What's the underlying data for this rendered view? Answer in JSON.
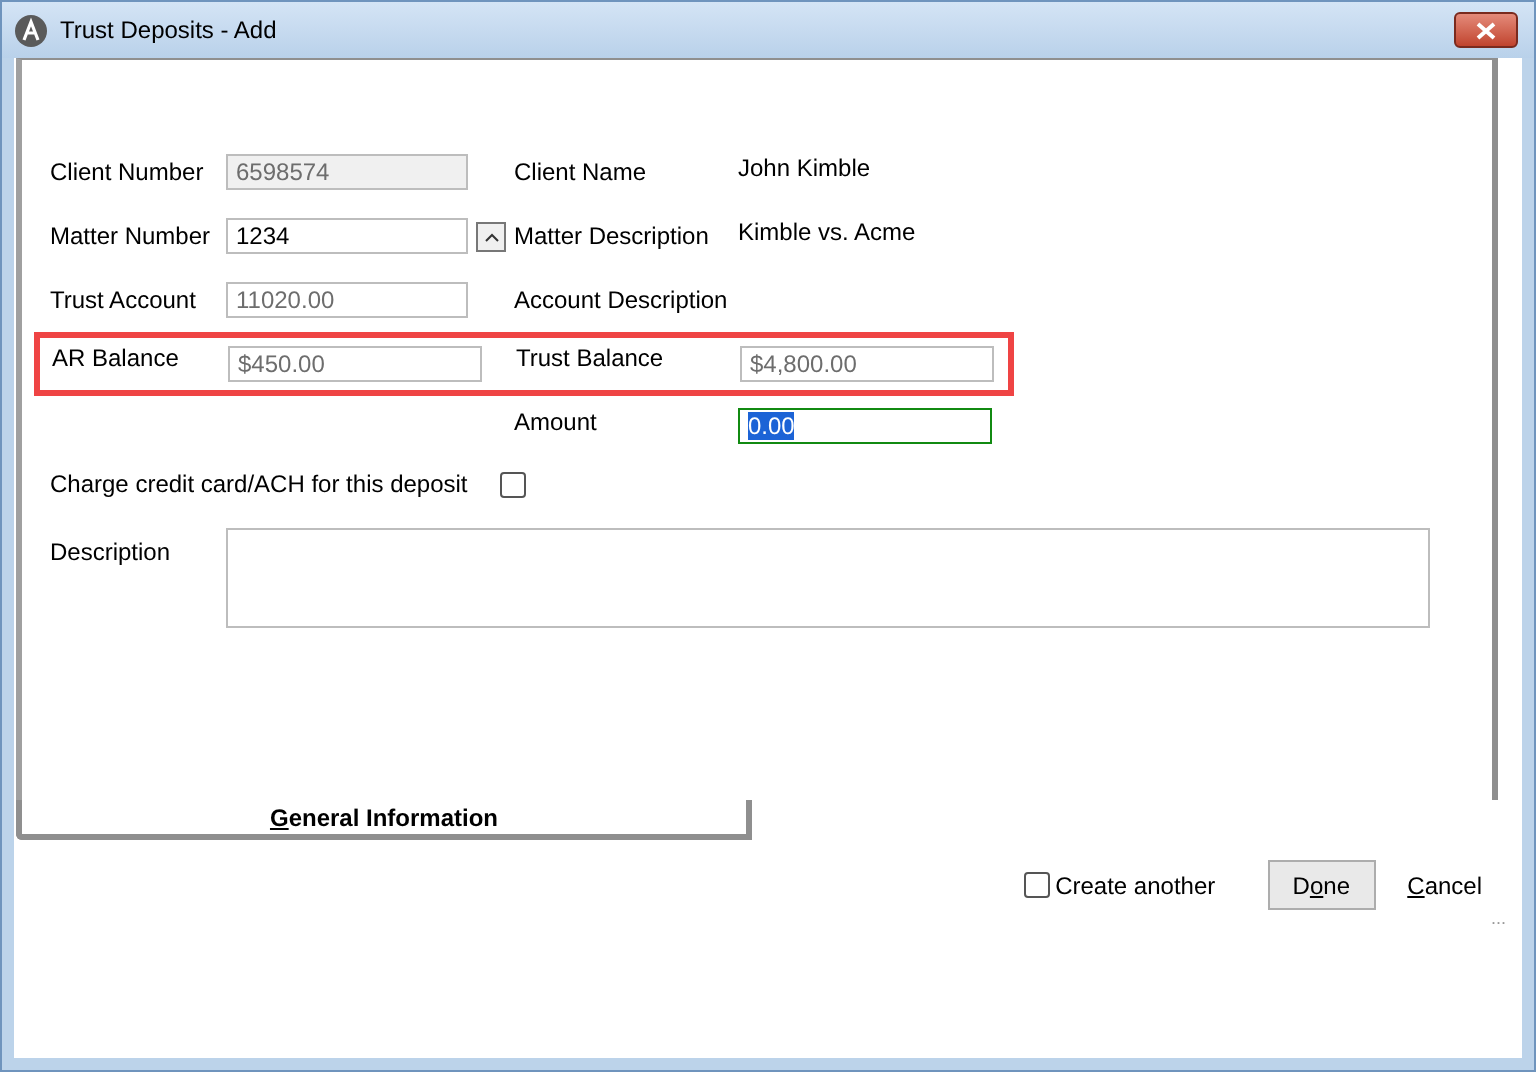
{
  "window": {
    "title": "Trust Deposits - Add"
  },
  "fields": [
    {
      "label": "Client Number",
      "value": "6598574",
      "kind": "readonly",
      "right_label": "Client Name",
      "right_value": "John Kimble"
    },
    {
      "label": "Matter Number",
      "value": "1234",
      "kind": "lookup",
      "right_label": "Matter Description",
      "right_value": "Kimble vs. Acme"
    },
    {
      "label": "Trust Account",
      "value": "11020.00",
      "kind": "disabled",
      "right_label": "Account Description"
    }
  ],
  "balances": {
    "highlighted": true,
    "ar_label": "AR Balance",
    "ar_value": "$450.00",
    "trust_label": "Trust Balance",
    "trust_value": "$4,800.00"
  },
  "amount": {
    "label": "Amount",
    "value": "0.00"
  },
  "charge_card": {
    "label": "Charge credit card/ACH for this deposit",
    "checked": false
  },
  "description": {
    "label": "Description"
  },
  "tabs": [
    {
      "label": [
        {
          "text": "G",
          "underline": true
        },
        {
          "text": "eneral Information",
          "underline": false
        }
      ],
      "selected": true
    }
  ],
  "footer": {
    "create_another": {
      "label": "Create another",
      "checked": false
    },
    "buttons": [
      {
        "label": [
          {
            "text": "D",
            "underline": false
          },
          {
            "text": "o",
            "underline": true
          },
          {
            "text": "ne",
            "underline": false
          }
        ],
        "kind": "button"
      },
      {
        "label": [
          {
            "text": "C",
            "underline": true
          },
          {
            "text": "ancel",
            "underline": false
          }
        ],
        "kind": "link"
      }
    ],
    "more": "..."
  }
}
